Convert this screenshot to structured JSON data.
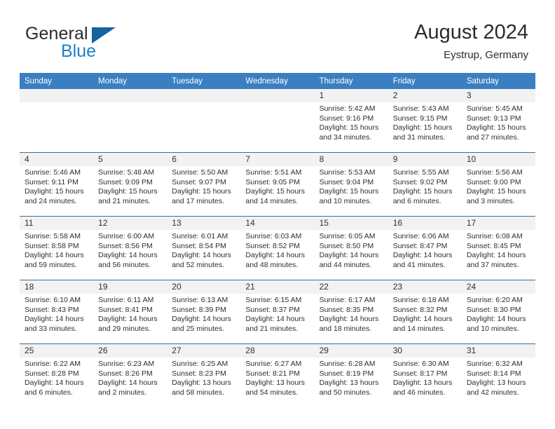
{
  "brand": {
    "name_part1": "General",
    "name_part2": "Blue",
    "mark": "triangle-logo"
  },
  "header": {
    "title": "August 2024",
    "subtitle": "Eystrup, Germany"
  },
  "weekday_headers": [
    "Sunday",
    "Monday",
    "Tuesday",
    "Wednesday",
    "Thursday",
    "Friday",
    "Saturday"
  ],
  "colors": {
    "header_band": "#3a7fc1",
    "row_divider": "#3f6e91",
    "daynum_band": "#f2f2f2",
    "brand_blue": "#1c7fc4",
    "brand_mark": "#15639f",
    "text": "#2e2e2e"
  },
  "weeks": [
    [
      {
        "day": "",
        "empty": true
      },
      {
        "day": "",
        "empty": true
      },
      {
        "day": "",
        "empty": true
      },
      {
        "day": "",
        "empty": true
      },
      {
        "day": "1",
        "sunrise": "Sunrise: 5:42 AM",
        "sunset": "Sunset: 9:16 PM",
        "daylight": "Daylight: 15 hours and 34 minutes."
      },
      {
        "day": "2",
        "sunrise": "Sunrise: 5:43 AM",
        "sunset": "Sunset: 9:15 PM",
        "daylight": "Daylight: 15 hours and 31 minutes."
      },
      {
        "day": "3",
        "sunrise": "Sunrise: 5:45 AM",
        "sunset": "Sunset: 9:13 PM",
        "daylight": "Daylight: 15 hours and 27 minutes."
      }
    ],
    [
      {
        "day": "4",
        "sunrise": "Sunrise: 5:46 AM",
        "sunset": "Sunset: 9:11 PM",
        "daylight": "Daylight: 15 hours and 24 minutes."
      },
      {
        "day": "5",
        "sunrise": "Sunrise: 5:48 AM",
        "sunset": "Sunset: 9:09 PM",
        "daylight": "Daylight: 15 hours and 21 minutes."
      },
      {
        "day": "6",
        "sunrise": "Sunrise: 5:50 AM",
        "sunset": "Sunset: 9:07 PM",
        "daylight": "Daylight: 15 hours and 17 minutes."
      },
      {
        "day": "7",
        "sunrise": "Sunrise: 5:51 AM",
        "sunset": "Sunset: 9:05 PM",
        "daylight": "Daylight: 15 hours and 14 minutes."
      },
      {
        "day": "8",
        "sunrise": "Sunrise: 5:53 AM",
        "sunset": "Sunset: 9:04 PM",
        "daylight": "Daylight: 15 hours and 10 minutes."
      },
      {
        "day": "9",
        "sunrise": "Sunrise: 5:55 AM",
        "sunset": "Sunset: 9:02 PM",
        "daylight": "Daylight: 15 hours and 6 minutes."
      },
      {
        "day": "10",
        "sunrise": "Sunrise: 5:56 AM",
        "sunset": "Sunset: 9:00 PM",
        "daylight": "Daylight: 15 hours and 3 minutes."
      }
    ],
    [
      {
        "day": "11",
        "sunrise": "Sunrise: 5:58 AM",
        "sunset": "Sunset: 8:58 PM",
        "daylight": "Daylight: 14 hours and 59 minutes."
      },
      {
        "day": "12",
        "sunrise": "Sunrise: 6:00 AM",
        "sunset": "Sunset: 8:56 PM",
        "daylight": "Daylight: 14 hours and 56 minutes."
      },
      {
        "day": "13",
        "sunrise": "Sunrise: 6:01 AM",
        "sunset": "Sunset: 8:54 PM",
        "daylight": "Daylight: 14 hours and 52 minutes."
      },
      {
        "day": "14",
        "sunrise": "Sunrise: 6:03 AM",
        "sunset": "Sunset: 8:52 PM",
        "daylight": "Daylight: 14 hours and 48 minutes."
      },
      {
        "day": "15",
        "sunrise": "Sunrise: 6:05 AM",
        "sunset": "Sunset: 8:50 PM",
        "daylight": "Daylight: 14 hours and 44 minutes."
      },
      {
        "day": "16",
        "sunrise": "Sunrise: 6:06 AM",
        "sunset": "Sunset: 8:47 PM",
        "daylight": "Daylight: 14 hours and 41 minutes."
      },
      {
        "day": "17",
        "sunrise": "Sunrise: 6:08 AM",
        "sunset": "Sunset: 8:45 PM",
        "daylight": "Daylight: 14 hours and 37 minutes."
      }
    ],
    [
      {
        "day": "18",
        "sunrise": "Sunrise: 6:10 AM",
        "sunset": "Sunset: 8:43 PM",
        "daylight": "Daylight: 14 hours and 33 minutes."
      },
      {
        "day": "19",
        "sunrise": "Sunrise: 6:11 AM",
        "sunset": "Sunset: 8:41 PM",
        "daylight": "Daylight: 14 hours and 29 minutes."
      },
      {
        "day": "20",
        "sunrise": "Sunrise: 6:13 AM",
        "sunset": "Sunset: 8:39 PM",
        "daylight": "Daylight: 14 hours and 25 minutes."
      },
      {
        "day": "21",
        "sunrise": "Sunrise: 6:15 AM",
        "sunset": "Sunset: 8:37 PM",
        "daylight": "Daylight: 14 hours and 21 minutes."
      },
      {
        "day": "22",
        "sunrise": "Sunrise: 6:17 AM",
        "sunset": "Sunset: 8:35 PM",
        "daylight": "Daylight: 14 hours and 18 minutes."
      },
      {
        "day": "23",
        "sunrise": "Sunrise: 6:18 AM",
        "sunset": "Sunset: 8:32 PM",
        "daylight": "Daylight: 14 hours and 14 minutes."
      },
      {
        "day": "24",
        "sunrise": "Sunrise: 6:20 AM",
        "sunset": "Sunset: 8:30 PM",
        "daylight": "Daylight: 14 hours and 10 minutes."
      }
    ],
    [
      {
        "day": "25",
        "sunrise": "Sunrise: 6:22 AM",
        "sunset": "Sunset: 8:28 PM",
        "daylight": "Daylight: 14 hours and 6 minutes."
      },
      {
        "day": "26",
        "sunrise": "Sunrise: 6:23 AM",
        "sunset": "Sunset: 8:26 PM",
        "daylight": "Daylight: 14 hours and 2 minutes."
      },
      {
        "day": "27",
        "sunrise": "Sunrise: 6:25 AM",
        "sunset": "Sunset: 8:23 PM",
        "daylight": "Daylight: 13 hours and 58 minutes."
      },
      {
        "day": "28",
        "sunrise": "Sunrise: 6:27 AM",
        "sunset": "Sunset: 8:21 PM",
        "daylight": "Daylight: 13 hours and 54 minutes."
      },
      {
        "day": "29",
        "sunrise": "Sunrise: 6:28 AM",
        "sunset": "Sunset: 8:19 PM",
        "daylight": "Daylight: 13 hours and 50 minutes."
      },
      {
        "day": "30",
        "sunrise": "Sunrise: 6:30 AM",
        "sunset": "Sunset: 8:17 PM",
        "daylight": "Daylight: 13 hours and 46 minutes."
      },
      {
        "day": "31",
        "sunrise": "Sunrise: 6:32 AM",
        "sunset": "Sunset: 8:14 PM",
        "daylight": "Daylight: 13 hours and 42 minutes."
      }
    ]
  ]
}
